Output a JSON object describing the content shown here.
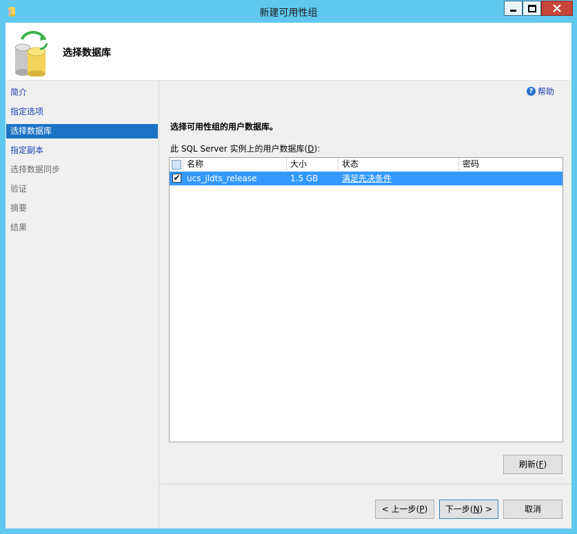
{
  "window": {
    "title": "新建可用性组",
    "controls": {
      "minimize": "minimize-icon",
      "maximize": "maximize-icon",
      "close": "close-icon"
    }
  },
  "header": {
    "title": "选择数据库"
  },
  "nav": {
    "items": [
      {
        "label": "简介",
        "state": "link"
      },
      {
        "label": "指定选项",
        "state": "link"
      },
      {
        "label": "选择数据库",
        "state": "selected"
      },
      {
        "label": "指定副本",
        "state": "link"
      },
      {
        "label": "选择数据同步",
        "state": "disabled"
      },
      {
        "label": "验证",
        "state": "disabled"
      },
      {
        "label": "摘要",
        "state": "disabled"
      },
      {
        "label": "结果",
        "state": "disabled"
      }
    ]
  },
  "main": {
    "help_label": "帮助",
    "instruction": "选择可用性组的用户数据库。",
    "list_label_prefix": "此 SQL Server 实例上的用户数据库(",
    "list_label_key": "D",
    "list_label_suffix": "):",
    "columns": [
      "名称",
      "大小",
      "状态",
      "密码"
    ],
    "rows": [
      {
        "checked": true,
        "name": "ucs_jldts_release",
        "size": "1.5 GB",
        "status": "满足先决条件",
        "password": ""
      }
    ]
  },
  "buttons": {
    "refresh": {
      "label": "刷新(",
      "key": "F",
      "suffix": ")"
    },
    "prev": {
      "label": "< 上一步(",
      "key": "P",
      "suffix": ")"
    },
    "next": {
      "label": "下一步(",
      "key": "N",
      "suffix": ") >"
    },
    "cancel": {
      "label": "取消"
    }
  },
  "colors": {
    "selection": "#1c73c4",
    "row_highlight": "#3399ff",
    "close_button": "#c7463a",
    "link": "#1a3fb0"
  }
}
